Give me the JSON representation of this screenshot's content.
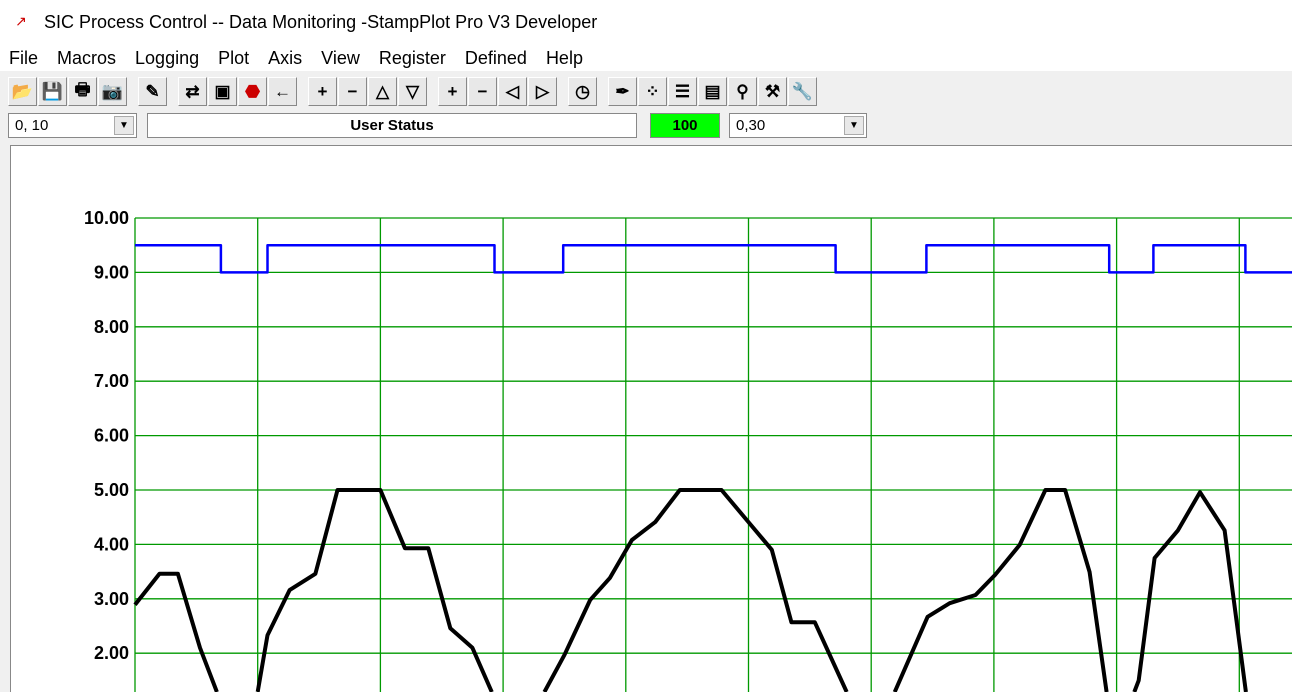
{
  "window": {
    "title": "SIC Process Control -- Data Monitoring  -StampPlot Pro V3 Developer",
    "icon": "stampplot-app-icon"
  },
  "menu": [
    "File",
    "Macros",
    "Logging",
    "Plot",
    "Axis",
    "View",
    "Register",
    "Defined",
    "Help"
  ],
  "toolbar": [
    {
      "icon": "open-folder-icon",
      "glyph": "📂"
    },
    {
      "icon": "save-disk-icon",
      "glyph": "💾"
    },
    {
      "icon": "printer-icon",
      "glyph": "🖶"
    },
    {
      "icon": "camera-icon",
      "glyph": "📷"
    },
    null,
    {
      "icon": "magic-wand-icon",
      "glyph": "✎"
    },
    null,
    {
      "icon": "connect-handshake-icon",
      "glyph": "⇄"
    },
    {
      "icon": "monitor-icon",
      "glyph": "▣"
    },
    {
      "icon": "stop-icon",
      "glyph": "⬣"
    },
    {
      "icon": "arrow-left-icon",
      "glyph": "←"
    },
    null,
    {
      "icon": "plus-y-icon",
      "glyph": "+"
    },
    {
      "icon": "minus-y-icon",
      "glyph": "−"
    },
    {
      "icon": "scroll-up-icon",
      "glyph": "△"
    },
    {
      "icon": "scroll-down-icon",
      "glyph": "▽"
    },
    null,
    {
      "icon": "plus-x-icon",
      "glyph": "+"
    },
    {
      "icon": "minus-x-icon",
      "glyph": "−"
    },
    {
      "icon": "scroll-left-icon",
      "glyph": "◁"
    },
    {
      "icon": "scroll-right-icon",
      "glyph": "▷"
    },
    null,
    {
      "icon": "clock-icon",
      "glyph": "◷"
    },
    null,
    {
      "icon": "pen-icon",
      "glyph": "✒"
    },
    {
      "icon": "plot-points-icon",
      "glyph": "⁘"
    },
    {
      "icon": "notes-icon",
      "glyph": "☰"
    },
    {
      "icon": "notebook-icon",
      "glyph": "▤"
    },
    {
      "icon": "probe-icon",
      "glyph": "⚲"
    },
    {
      "icon": "tools-icon",
      "glyph": "⚒"
    },
    {
      "icon": "wrench-icon",
      "glyph": "🔧"
    }
  ],
  "status": {
    "y_range": "0, 10",
    "user_status": "User Status",
    "value": "100",
    "value_color": "#00ff00",
    "x_range": "0,30"
  },
  "chart_data": {
    "type": "line",
    "ylim": [
      0,
      10
    ],
    "y_ticks": [
      "10.00",
      "9.00",
      "8.00",
      "7.00",
      "6.00",
      "5.00",
      "4.00",
      "3.00",
      "2.00"
    ],
    "grid": true,
    "grid_color": "#009900",
    "series": [
      {
        "color": "#0000ff",
        "step": true,
        "points": [
          [
            0,
            9.5
          ],
          [
            0.7,
            9.5
          ],
          [
            0.7,
            9
          ],
          [
            1.08,
            9
          ],
          [
            1.08,
            9.5
          ],
          [
            2.93,
            9.5
          ],
          [
            2.93,
            9
          ],
          [
            3.49,
            9
          ],
          [
            3.49,
            9.5
          ],
          [
            5.71,
            9.5
          ],
          [
            5.71,
            9
          ],
          [
            6.45,
            9
          ],
          [
            6.45,
            9.5
          ],
          [
            7.94,
            9.5
          ],
          [
            7.94,
            9
          ],
          [
            8.3,
            9
          ],
          [
            8.3,
            9.5
          ],
          [
            9.05,
            9.5
          ],
          [
            9.05,
            9
          ],
          [
            9.5,
            9
          ]
        ]
      },
      {
        "color": "#000000",
        "points": [
          [
            0,
            2.89
          ],
          [
            0.2,
            3.46
          ],
          [
            0.35,
            3.46
          ],
          [
            0.53,
            2.1
          ],
          [
            0.8,
            0.5
          ],
          [
            1.0,
            1.29
          ],
          [
            1.08,
            2.33
          ],
          [
            1.26,
            3.16
          ],
          [
            1.47,
            3.46
          ],
          [
            1.65,
            5.0
          ],
          [
            2.0,
            5.0
          ],
          [
            2.2,
            3.93
          ],
          [
            2.39,
            3.93
          ],
          [
            2.57,
            2.46
          ],
          [
            2.75,
            2.1
          ],
          [
            3.1,
            0.3
          ],
          [
            3.5,
            1.97
          ],
          [
            3.71,
            2.98
          ],
          [
            3.87,
            3.38
          ],
          [
            4.05,
            4.08
          ],
          [
            4.24,
            4.41
          ],
          [
            4.44,
            5.0
          ],
          [
            4.78,
            5.0
          ],
          [
            5.0,
            4.41
          ],
          [
            5.19,
            3.9
          ],
          [
            5.35,
            2.57
          ],
          [
            5.54,
            2.57
          ],
          [
            6.0,
            0.3
          ],
          [
            6.46,
            2.67
          ],
          [
            6.64,
            2.92
          ],
          [
            6.85,
            3.07
          ],
          [
            7.01,
            3.44
          ],
          [
            7.21,
            3.99
          ],
          [
            7.42,
            5.0
          ],
          [
            7.58,
            5.0
          ],
          [
            7.78,
            3.49
          ],
          [
            7.98,
            0.3
          ],
          [
            8.18,
            1.5
          ],
          [
            8.31,
            3.75
          ],
          [
            8.5,
            4.26
          ],
          [
            8.68,
            4.96
          ],
          [
            8.88,
            4.26
          ],
          [
            9.1,
            0.5
          ]
        ]
      }
    ]
  }
}
